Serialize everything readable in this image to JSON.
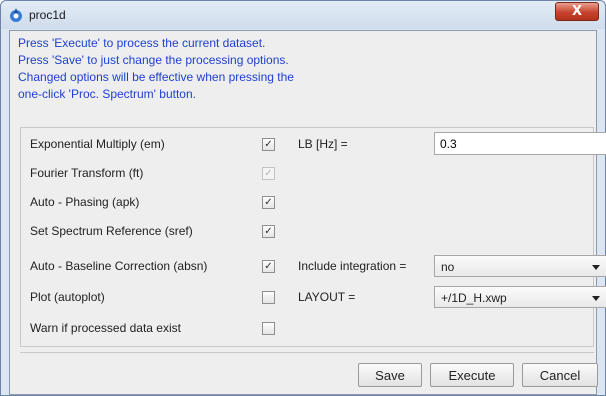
{
  "window": {
    "title": "proc1d",
    "close_label": "X",
    "title_icon": "app-icon"
  },
  "info_lines": [
    "Press 'Execute' to process the current dataset.",
    "Press 'Save' to just change the processing options.",
    "Changed options will be effective when pressing the",
    "one-click 'Proc. Spectrum' button."
  ],
  "options": [
    {
      "label": "Exponential Multiply (em)",
      "checked": true,
      "enabled": true,
      "param": {
        "label": "LB [Hz] =",
        "kind": "text",
        "value": "0.3"
      }
    },
    {
      "label": "Fourier Transform (ft)",
      "checked": true,
      "enabled": false
    },
    {
      "label": "Auto - Phasing (apk)",
      "checked": true,
      "enabled": true
    },
    {
      "label": "Set Spectrum Reference (sref)",
      "checked": true,
      "enabled": true
    },
    {
      "label": "Auto - Baseline Correction (absn)",
      "checked": true,
      "enabled": true,
      "param": {
        "label": "Include integration =",
        "kind": "select",
        "value": "no"
      }
    },
    {
      "label": "Plot (autoplot)",
      "checked": false,
      "enabled": true,
      "param": {
        "label": "LAYOUT =",
        "kind": "select",
        "value": "+/1D_H.xwp"
      }
    },
    {
      "label": "Warn if processed data exist",
      "checked": false,
      "enabled": true
    }
  ],
  "buttons": {
    "save": "Save",
    "execute": "Execute",
    "cancel": "Cancel"
  },
  "colors": {
    "info_text": "#1f3fd1",
    "window_frame": "#dbe6f2",
    "close_button": "#c7432d"
  }
}
